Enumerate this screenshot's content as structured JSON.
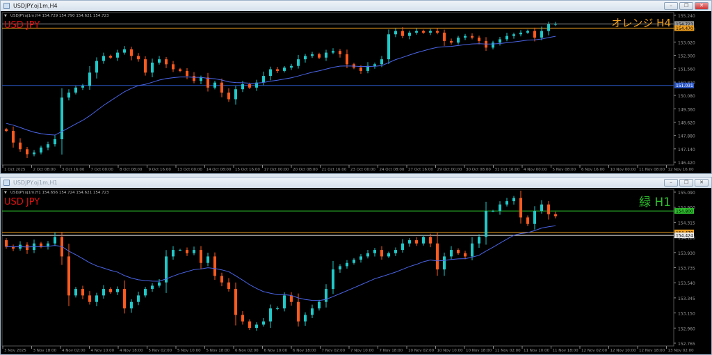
{
  "windows": [
    {
      "title": "USDJPY.oj1m,H4",
      "info": "USDJPY.oj1m,H4  154.729 154.790 154.621 154.723",
      "symbol_label": "USD JPY",
      "corner_label": "オレンジ H4",
      "corner_color": "#f0a020",
      "price_ticks": [
        "155.240",
        "153.760",
        "153.020",
        "152.300",
        "151.560",
        "150.820",
        "150.080",
        "149.360",
        "148.620",
        "147.880",
        "147.140",
        "146.420"
      ],
      "time_ticks": [
        "1 Oct 2025",
        "2 Oct 08:00",
        "3 Oct 16:00",
        "7 Oct 00:00",
        "8 Oct 08:00",
        "9 Oct 16:00",
        "13 Oct 00:00",
        "14 Oct 08:00",
        "15 Oct 16:00",
        "17 Oct 00:00",
        "20 Oct 08:00",
        "21 Oct 16:00",
        "23 Oct 00:00",
        "24 Oct 08:00",
        "27 Oct 16:00",
        "29 Oct 00:00",
        "30 Oct 08:00",
        "31 Oct 16:00",
        "4 Nov 00:00",
        "5 Nov 08:00",
        "6 Nov 16:00",
        "10 Nov 00:00",
        "11 Nov 08:00",
        "12 Nov 16:00"
      ],
      "levels": [
        {
          "price": 154.723,
          "label": "154.723",
          "color": "#9a9a9a",
          "text": "#000"
        },
        {
          "price": 154.47,
          "label": "154.470",
          "color": "#f0a020",
          "text": "#000"
        },
        {
          "price": 151.031,
          "label": "151.031",
          "color": "#2a56c6",
          "text": "#fff"
        }
      ],
      "range": [
        146.42,
        155.24
      ]
    },
    {
      "title": "USDJPY.oj1m,H1",
      "info": "USDJPY.oj1m,H1  154.656 154.724 154.621 154.723",
      "symbol_label": "USD JPY",
      "corner_label": "緑 H1",
      "corner_color": "#2ec02e",
      "price_ticks": [
        "155.090",
        "154.900",
        "154.315",
        "154.120",
        "153.930",
        "153.735",
        "153.540",
        "153.345",
        "153.150",
        "152.960",
        "152.765"
      ],
      "time_ticks": [
        "3 Nov 2025",
        "3 Nov 18:00",
        "4 Nov 02:00",
        "4 Nov 10:00",
        "4 Nov 18:00",
        "5 Nov 02:00",
        "5 Nov 10:00",
        "5 Nov 18:00",
        "6 Nov 02:00",
        "6 Nov 10:00",
        "6 Nov 18:00",
        "7 Nov 02:00",
        "7 Nov 10:00",
        "7 Nov 18:00",
        "10 Nov 02:00",
        "10 Nov 10:00",
        "10 Nov 18:00",
        "11 Nov 02:00",
        "11 Nov 10:00",
        "11 Nov 18:00",
        "12 Nov 02:00",
        "12 Nov 10:00",
        "12 Nov 18:00",
        "13 Nov 02:00"
      ],
      "levels": [
        {
          "price": 154.8,
          "label": "154.800",
          "color": "#2ec02e",
          "text": "#000"
        },
        {
          "price": 154.47,
          "label": "154.470",
          "color": "#f0a020",
          "text": "#000"
        },
        {
          "price": 154.424,
          "label": "154.424",
          "color": "#e8e8e8",
          "text": "#000"
        }
      ],
      "range": [
        152.765,
        155.09
      ]
    }
  ],
  "chart_data": [
    {
      "type": "candlestick",
      "title": "USDJPY.oj1m,H4",
      "ylim": [
        146.42,
        155.24
      ],
      "up_color": "#20c8c8",
      "down_color": "#ff5a1e",
      "ma_color": "#4a64e6",
      "closes": [
        148.3,
        147.6,
        147.2,
        146.9,
        147.0,
        147.3,
        147.5,
        147.8,
        150.3,
        150.6,
        150.9,
        151.0,
        151.8,
        152.5,
        152.8,
        152.7,
        153.0,
        153.2,
        152.8,
        152.6,
        151.8,
        152.4,
        152.6,
        152.3,
        152.0,
        151.9,
        151.6,
        151.3,
        151.5,
        150.9,
        151.2,
        150.6,
        150.2,
        150.8,
        151.1,
        150.9,
        151.2,
        151.6,
        152.0,
        151.9,
        152.1,
        152.2,
        152.6,
        152.8,
        152.9,
        152.7,
        153.0,
        153.1,
        152.9,
        152.3,
        152.1,
        151.9,
        152.2,
        152.3,
        152.6,
        154.1,
        154.3,
        154.0,
        154.2,
        154.3,
        154.2,
        154.3,
        154.2,
        153.7,
        153.6,
        153.9,
        154.0,
        153.9,
        153.7,
        153.3,
        153.6,
        153.8,
        154.0,
        154.1,
        154.2,
        154.3,
        153.9,
        154.3,
        154.7,
        154.72
      ]
    },
    {
      "type": "candlestick",
      "title": "USDJPY.oj1m,H1",
      "ylim": [
        152.765,
        155.09
      ],
      "up_color": "#20c8c8",
      "down_color": "#ff5a1e",
      "ma_color": "#4a64e6",
      "closes": [
        154.25,
        154.22,
        154.28,
        154.2,
        154.3,
        154.25,
        154.3,
        154.4,
        154.1,
        153.5,
        153.6,
        153.5,
        153.4,
        153.5,
        153.6,
        153.55,
        153.6,
        153.3,
        153.4,
        153.5,
        153.6,
        153.65,
        153.7,
        154.1,
        154.2,
        154.2,
        154.15,
        154.2,
        154.0,
        154.1,
        153.8,
        153.7,
        153.6,
        153.2,
        153.1,
        153.0,
        153.05,
        153.1,
        153.3,
        153.3,
        153.5,
        153.4,
        153.1,
        153.2,
        153.3,
        153.4,
        153.6,
        153.9,
        153.95,
        154.0,
        154.05,
        154.1,
        154.15,
        154.2,
        154.1,
        154.15,
        154.2,
        154.3,
        154.35,
        154.3,
        154.4,
        154.3,
        153.9,
        154.1,
        154.2,
        154.15,
        154.1,
        154.3,
        154.4,
        154.8,
        154.8,
        154.9,
        154.95,
        155.0,
        154.7,
        154.6,
        154.8,
        154.9,
        154.75,
        154.72
      ]
    }
  ]
}
